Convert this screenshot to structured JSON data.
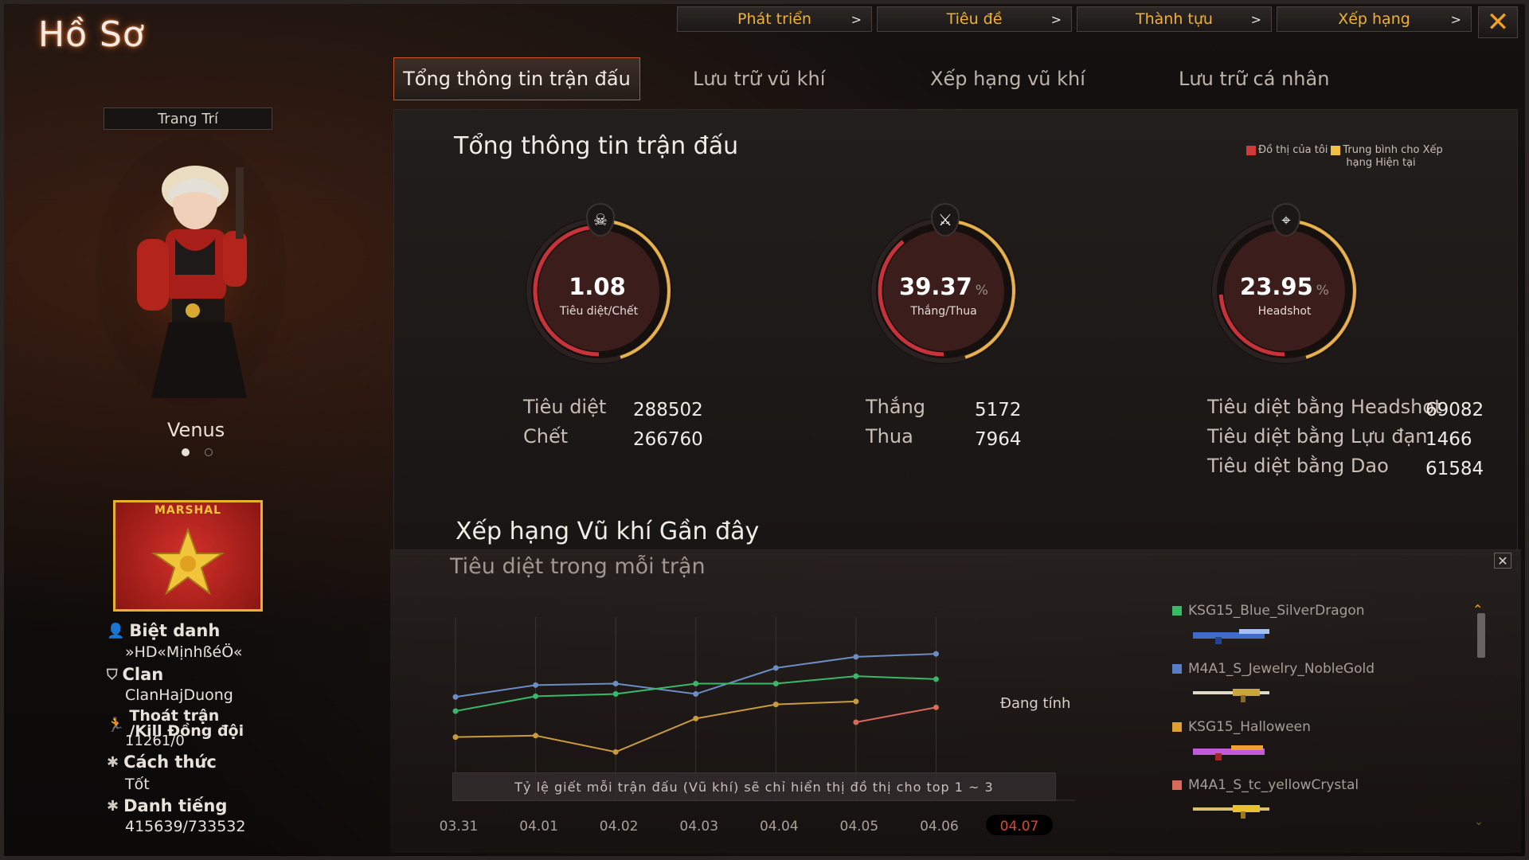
{
  "window": {
    "title": "Hồ Sơ"
  },
  "top_buttons": [
    {
      "label": "Phát triển"
    },
    {
      "label": "Tiêu đề"
    },
    {
      "label": "Thành tựu"
    },
    {
      "label": "Xếp hạng"
    }
  ],
  "tabs": [
    {
      "label": "Tổng thông tin trận đấu",
      "active": true
    },
    {
      "label": "Lưu trữ vũ khí"
    },
    {
      "label": "Xếp hạng vũ khí"
    },
    {
      "label": "Lưu trữ cá nhân"
    }
  ],
  "character": {
    "decorate_label": "Trang Trí",
    "name": "Venus"
  },
  "rank_badge": {
    "label": "MARSHAL"
  },
  "profile": {
    "nickname_label": "Biệt danh",
    "nickname": "»HD«MịnhßéÖ«",
    "clan_label": "Clan",
    "clan": "ClanHajDuong",
    "leave_label_1": "Thoát trận",
    "leave_label_2": "/Kill Đồng đội",
    "leave_value": "11261/0",
    "manner_label": "Cách thức",
    "manner": "Tốt",
    "reputation_label": "Danh tiếng",
    "reputation": "415639/733532"
  },
  "summary": {
    "title": "Tổng thông tin trận đấu",
    "legend_mine": "Đồ thị của tôi",
    "legend_avg_1": "Trung bình cho Xếp",
    "legend_avg_2": "hạng Hiện tại",
    "gauges": [
      {
        "value": "1.08",
        "label": "Tiêu diệt/Chết",
        "percent": "",
        "fraction": 0.52
      },
      {
        "value": "39.37",
        "label": "Thắng/Thua",
        "percent": "%",
        "fraction": 0.39
      },
      {
        "value": "23.95",
        "label": "Headshot",
        "percent": "%",
        "fraction": 0.24
      }
    ],
    "stats": {
      "kill_label": "Tiêu diệt",
      "kill_value": "288502",
      "death_label": "Chết",
      "death_value": "266760",
      "win_label": "Thắng",
      "win_value": "5172",
      "lose_label": "Thua",
      "lose_value": "7964",
      "hs_label": "Tiêu diệt bằng Headshot",
      "hs_value": "69082",
      "grenade_label": "Tiêu diệt bằng Lựu đạn",
      "grenade_value": "1466",
      "knife_label": "Tiêu diệt bằng Dao",
      "knife_value": "61584"
    }
  },
  "recent": {
    "title": "Xếp hạng Vũ khí Gần đây",
    "subtitle": "Tiêu diệt trong mỗi trận",
    "calculating": "Đang tính",
    "note": "Tỷ lệ giết mỗi trận đấu (Vũ khí) sẽ chỉ hiển thị đồ thị cho top 1 ~ 3"
  },
  "colors": {
    "accent": "#c8522a",
    "gold": "#f0b030",
    "series_blue": "#6c8cc4",
    "series_green": "#3ab86a",
    "series_gold": "#c99a3e",
    "series_red": "#d86a5a"
  },
  "chart_data": {
    "type": "line",
    "categories": [
      "03.31",
      "04.01",
      "04.02",
      "04.03",
      "04.04",
      "04.05",
      "04.06",
      "04.07"
    ],
    "highlight_category": "04.07",
    "series": [
      {
        "name": "KSG15_Blue_SilverDragon",
        "color": "#6c8cc4",
        "values": [
          0.54,
          0.7,
          0.72,
          0.58,
          0.93,
          1.08,
          1.12,
          null
        ]
      },
      {
        "name": "M4A1_S_Jewelry_NobleGold",
        "color": "#3ab86a",
        "values": [
          0.35,
          0.55,
          0.58,
          0.72,
          0.72,
          0.82,
          0.78,
          null
        ]
      },
      {
        "name": "KSG15_Halloween",
        "color": "#c99a3e",
        "values": [
          0.0,
          0.02,
          -0.2,
          0.25,
          0.44,
          0.48,
          null,
          null
        ]
      },
      {
        "name": "M4A1_S_tc_yellowCrystal",
        "color": "#d86a5a",
        "values": [
          null,
          null,
          null,
          null,
          null,
          0.2,
          0.4,
          null
        ]
      }
    ],
    "grid": true
  }
}
